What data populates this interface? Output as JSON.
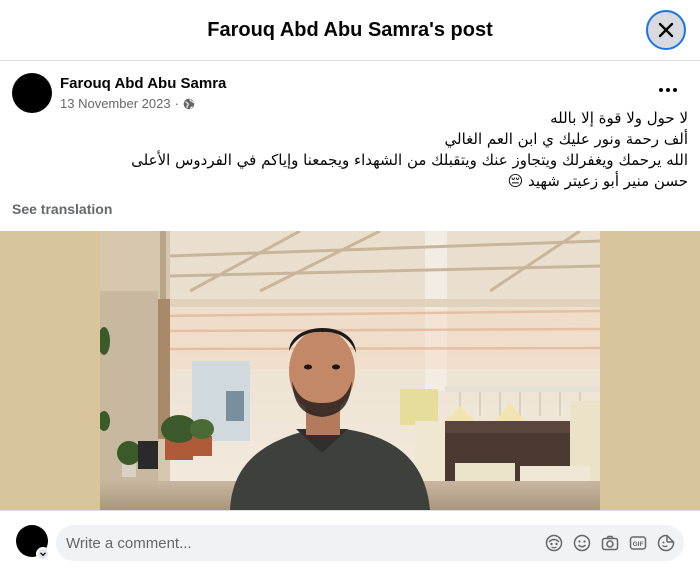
{
  "dialog": {
    "title": "Farouq Abd Abu Samra's post"
  },
  "post": {
    "author": "Farouq Abd Abu Samra",
    "date": "13 November 2023",
    "separator": "·",
    "privacy_icon": "globe-icon",
    "lines": [
      "لا حول ولا قوة إلا بالله",
      "ألف رحمة ونور عليك ي ابن العم الغالي",
      "الله يرحمك ويغفرلك ويتجاوز عنك ويتقبلك من الشهداء ويجمعنا وإياكم في الفردوس الأعلى",
      "حسن منير أبو زعيتر شهيد 😔"
    ],
    "see_translation": "See translation"
  },
  "comment": {
    "placeholder": "Write a comment...",
    "icons": [
      "avatar-sticker-icon",
      "emoji-icon",
      "camera-icon",
      "gif-icon",
      "sticker-icon"
    ]
  },
  "colors": {
    "accent": "#1b74e4",
    "secondary_text": "#65676b",
    "input_bg": "#f0f2f5"
  }
}
